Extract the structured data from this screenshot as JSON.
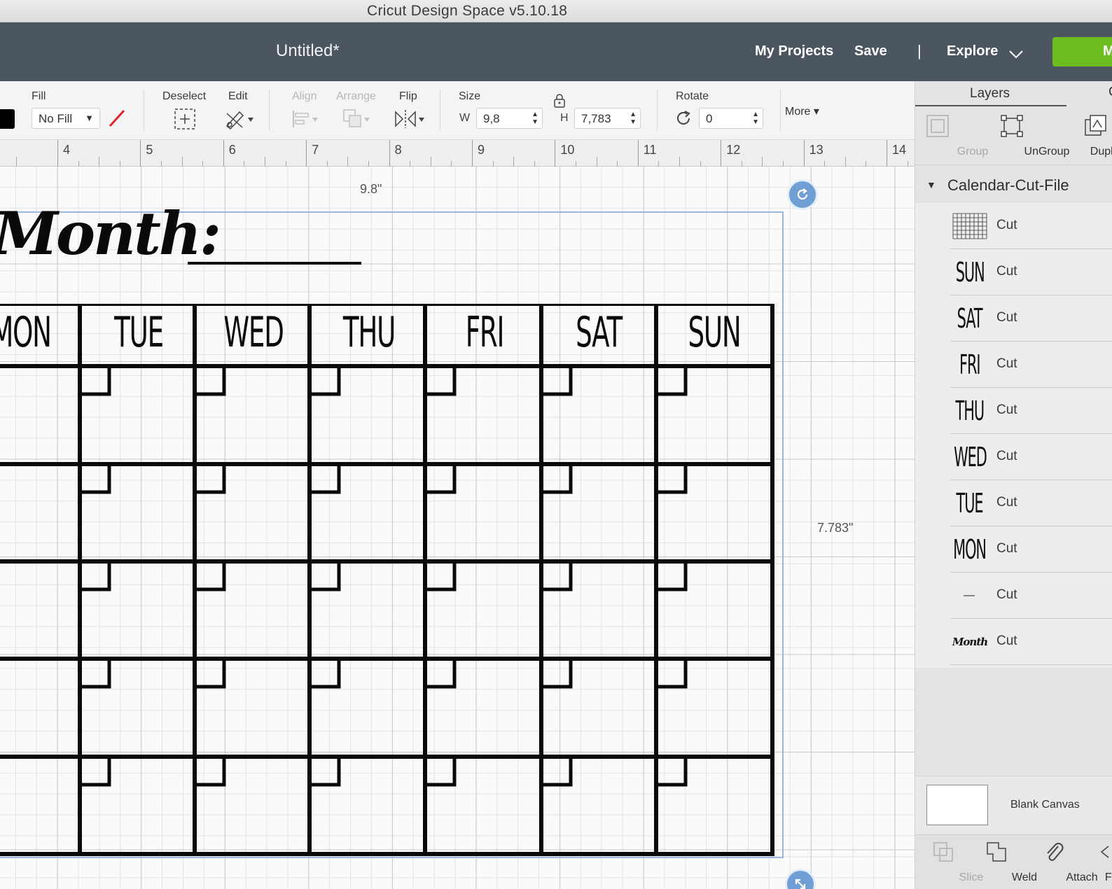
{
  "window": {
    "title": "Cricut Design Space  v5.10.18"
  },
  "header": {
    "doc_title": "Untitled*",
    "my_projects": "My Projects",
    "save": "Save",
    "separator": "|",
    "explore": "Explore",
    "make_it": "M",
    "make_color": "#6cbd1f",
    "bg_color": "#4c5660"
  },
  "toolbar": {
    "fill_label": "Fill",
    "fill_value": "No Fill",
    "fill_color": "#000000",
    "deselect_label": "Deselect",
    "edit_label": "Edit",
    "align_label": "Align",
    "arrange_label": "Arrange",
    "flip_label": "Flip",
    "size_label": "Size",
    "w_label": "W",
    "w_value": "9,8",
    "h_label": "H",
    "h_value": "7,783",
    "rotate_label": "Rotate",
    "rotate_value": "0",
    "more_label": "More"
  },
  "ruler": {
    "marks": [
      "4",
      "5",
      "6",
      "7",
      "8",
      "9",
      "10",
      "11",
      "12",
      "13",
      "14"
    ]
  },
  "canvas": {
    "width_readout": "9.8\"",
    "height_readout": "7.783\"",
    "month_text": "Month:",
    "day_headers": [
      "MON",
      "TUE",
      "WED",
      "THU",
      "FRI",
      "SAT",
      "SUN"
    ]
  },
  "panel": {
    "tab_layers": "Layers",
    "tab_color": "C",
    "tools": {
      "group": "Group",
      "ungroup": "UnGroup",
      "duplicate": "Duplic"
    },
    "group_name": "Calendar-Cut-File",
    "layers": [
      {
        "thumb": "grid",
        "op": "Cut"
      },
      {
        "thumb": "SUN",
        "op": "Cut"
      },
      {
        "thumb": "SAT",
        "op": "Cut"
      },
      {
        "thumb": "FRI",
        "op": "Cut"
      },
      {
        "thumb": "THU",
        "op": "Cut"
      },
      {
        "thumb": "WED",
        "op": "Cut"
      },
      {
        "thumb": "TUE",
        "op": "Cut"
      },
      {
        "thumb": "MON",
        "op": "Cut"
      },
      {
        "thumb": "line",
        "op": "Cut"
      },
      {
        "thumb": "Month",
        "op": "Cut"
      }
    ],
    "blank_canvas": "Blank Canvas",
    "bottom_tools": {
      "slice": "Slice",
      "weld": "Weld",
      "attach": "Attach",
      "flatten": "Fla"
    }
  }
}
